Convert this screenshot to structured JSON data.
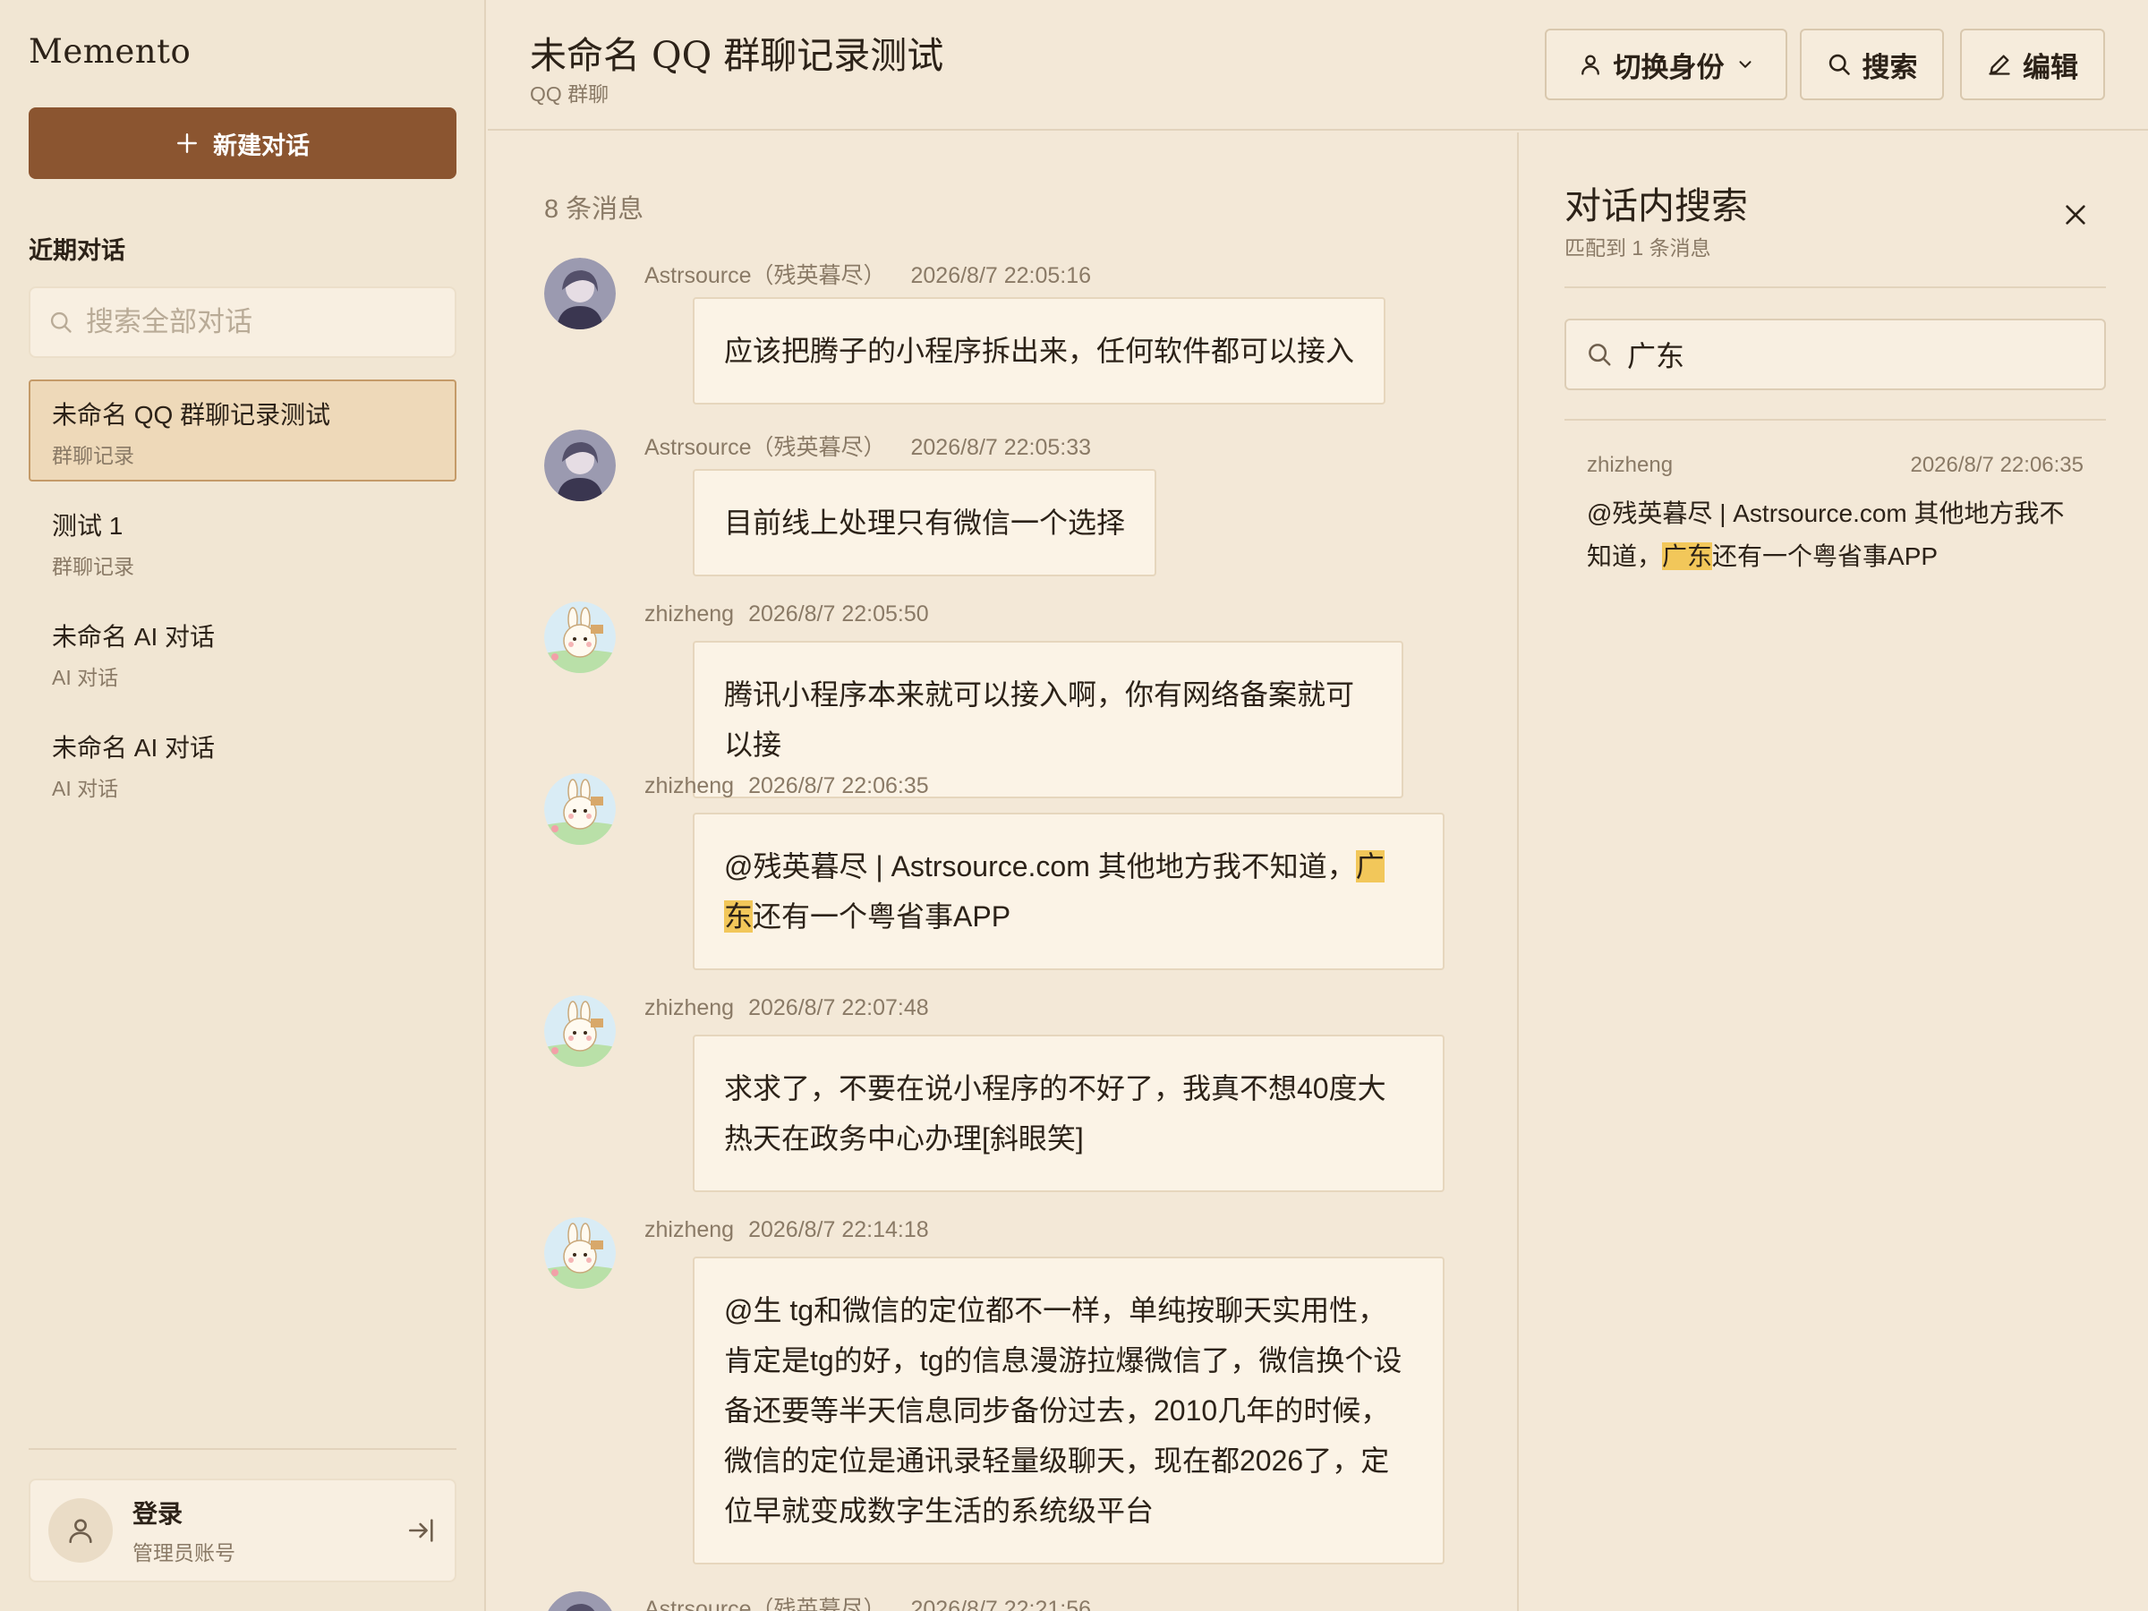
{
  "sidebar": {
    "brand": "Memento",
    "new_chat_label": "新建对话",
    "recent_title": "近期对话",
    "search_placeholder": "搜索全部对话",
    "conversations": [
      {
        "title": "未命名 QQ 群聊记录测试",
        "subtitle": "群聊记录",
        "active": true
      },
      {
        "title": "测试 1",
        "subtitle": "群聊记录",
        "active": false
      },
      {
        "title": "未命名 AI 对话",
        "subtitle": "AI 对话",
        "active": false
      },
      {
        "title": "未命名 AI 对话",
        "subtitle": "AI 对话",
        "active": false
      }
    ],
    "login": {
      "title": "登录",
      "subtitle": "管理员账号"
    }
  },
  "header": {
    "title": "未命名 QQ 群聊记录测试",
    "subtitle": "QQ 群聊",
    "switch_identity_label": "切换身份",
    "search_label": "搜索",
    "edit_label": "编辑"
  },
  "chat": {
    "count_label": "8 条消息",
    "messages": [
      {
        "sender": "Astrsource（残英暮尽）",
        "time": "2026/8/7 22:05:16",
        "text": "应该把腾子的小程序拆出来，任何软件都可以接入"
      },
      {
        "sender": "Astrsource（残英暮尽）",
        "time": "2026/8/7 22:05:33",
        "text": "目前线上处理只有微信一个选择"
      },
      {
        "sender": "zhizheng",
        "time": "2026/8/7 22:05:50",
        "text": "腾讯小程序本来就可以接入啊，你有网络备案就可以接"
      },
      {
        "sender": "zhizheng",
        "time": "2026/8/7 22:06:35",
        "text_before": "@残英暮尽 | Astrsource.com 其他地方我不知道，",
        "highlight_a": "广",
        "highlight_b": "东",
        "text_after": "还有一个粤省事APP"
      },
      {
        "sender": "zhizheng",
        "time": "2026/8/7 22:07:48",
        "line1": "求求了，不要在说小程序的不好了，我真不想40度大",
        "line2": "热天在政务中心办理[斜眼笑]"
      },
      {
        "sender": "zhizheng",
        "time": "2026/8/7 22:14:18",
        "lines": [
          "@生 tg和微信的定位都不一样，单纯按聊天实用性，",
          "肯定是tg的好，tg的信息漫游拉爆微信了，微信换个设",
          "备还要等半天信息同步备份过去，2010几年的时候，",
          "微信的定位是通讯录轻量级聊天，现在都2026了，定",
          "位早就变成数字生活的系统级平台"
        ]
      },
      {
        "sender": "Astrsource（残英暮尽）",
        "time": "2026/8/7 22:21:56"
      }
    ]
  },
  "search_panel": {
    "title": "对话内搜索",
    "subtitle": "匹配到 1 条消息",
    "query": "广东",
    "result": {
      "sender": "zhizheng",
      "time": "2026/8/7 22:06:35",
      "text_before": "@残英暮尽 | Astrsource.com 其他地方我不知道，",
      "highlight": "广东",
      "text_after": "还有一个粤省事APP"
    }
  },
  "colors": {
    "accent": "#8b5530",
    "background": "#f3e8d7",
    "highlight": "#f2c75a",
    "active_item": "#eed9b9"
  },
  "icons": [
    "plus-icon",
    "search-icon",
    "user-icon",
    "chevron-down-icon",
    "pencil-icon",
    "close-icon",
    "login-icon"
  ]
}
